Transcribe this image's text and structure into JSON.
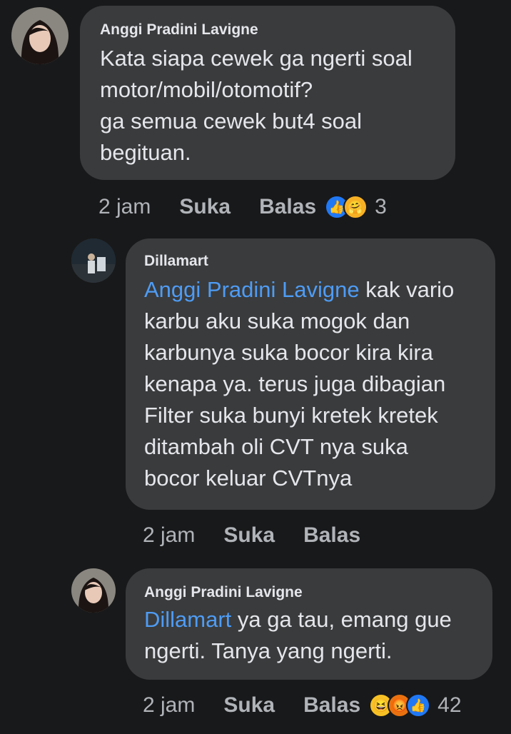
{
  "comments": [
    {
      "author": "Anggi Pradini Lavigne",
      "mention": "",
      "text": "Kata siapa cewek ga ngerti soal\nmotor/mobil/otomotif?\nga semua cewek but4 soal\nbegituan.",
      "time": "2 jam",
      "like_label": "Suka",
      "reply_label": "Balas",
      "reactions": [
        "like-icon",
        "care-icon"
      ],
      "reaction_count": "3"
    },
    {
      "author": "Dillamart",
      "mention": "Anggi Pradini Lavigne",
      "text": " kak vario\nkarbu aku suka mogok dan\nkarbunya suka bocor kira kira\nkenapa ya. terus juga dibagian\nFilter suka bunyi kretek kretek\nditambah oli CVT nya suka\nbocor keluar CVTnya",
      "time": "2 jam",
      "like_label": "Suka",
      "reply_label": "Balas"
    },
    {
      "author": "Anggi Pradini Lavigne",
      "mention": "Dillamart",
      "text": " ya ga tau, emang gue\nngerti. Tanya yang ngerti.",
      "time": "2 jam",
      "like_label": "Suka",
      "reply_label": "Balas",
      "reactions": [
        "haha-icon",
        "angry-icon",
        "like-icon"
      ],
      "reaction_count": "42"
    }
  ],
  "colors": {
    "background": "#18191a",
    "bubble": "#3a3b3c",
    "mention": "#4e9cf5",
    "meta": "#b0b3b8",
    "like_reaction": "#2078f4"
  }
}
